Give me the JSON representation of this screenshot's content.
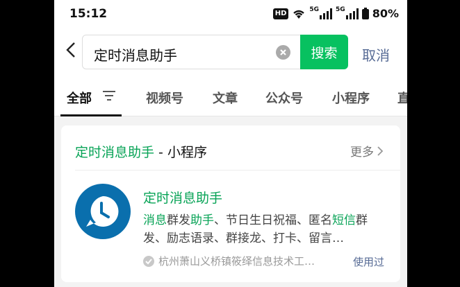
{
  "status_bar": {
    "time": "15:12",
    "hd_label": "HD",
    "network_label": "5G",
    "battery_percent": "80%"
  },
  "search": {
    "query": "定时消息助手",
    "search_button": "搜索",
    "cancel_label": "取消"
  },
  "tabs": [
    {
      "label": "全部",
      "active": true
    },
    {
      "label": "视频号"
    },
    {
      "label": "文章"
    },
    {
      "label": "公众号"
    },
    {
      "label": "小程序"
    },
    {
      "label": "直"
    }
  ],
  "result_card": {
    "title_highlight": "定时消息助手",
    "title_suffix": " - 小程序",
    "more_label": "更多",
    "app": {
      "name": "定时消息助手",
      "desc_parts": [
        {
          "text": "消息",
          "hl": true
        },
        {
          "text": "群发",
          "hl": false
        },
        {
          "text": "助手",
          "hl": true
        },
        {
          "text": "、节日生日祝福、匿名",
          "hl": false
        },
        {
          "text": "短信",
          "hl": true
        },
        {
          "text": "群发、励志语录、群接龙、打卡、留言…",
          "hl": false
        }
      ],
      "company": "杭州萧山义桥镇筱绎信息技术工…",
      "used_label": "使用过"
    }
  },
  "colors": {
    "accent_green": "#07c160",
    "link_blue": "#576b95",
    "app_icon_blue": "#0a6fad"
  }
}
